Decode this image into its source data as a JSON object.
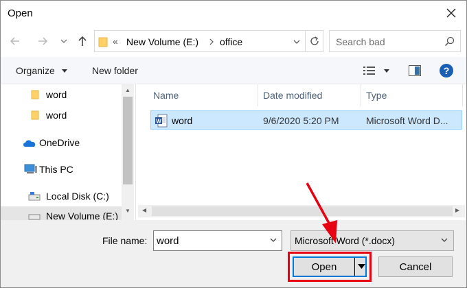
{
  "window": {
    "title": "Open"
  },
  "nav": {
    "path": [
      "New Volume (E:)",
      "office"
    ],
    "path_prefix": "«",
    "search_placeholder": "Search bad"
  },
  "toolbar": {
    "organize_label": "Organize",
    "new_folder_label": "New folder"
  },
  "sidebar": {
    "items": [
      {
        "label": "word",
        "icon": "folder-icon"
      },
      {
        "label": "word",
        "icon": "folder-icon"
      },
      {
        "label": "OneDrive",
        "icon": "onedrive-icon"
      },
      {
        "label": "This PC",
        "icon": "computer-icon"
      },
      {
        "label": "Local Disk (C:)",
        "icon": "drive-icon"
      },
      {
        "label": "New Volume (E:)",
        "icon": "drive-icon"
      }
    ]
  },
  "file_list": {
    "columns": [
      "Name",
      "Date modified",
      "Type"
    ],
    "rows": [
      {
        "name": "word",
        "date": "9/6/2020 5:20 PM",
        "type": "Microsoft Word D..."
      }
    ]
  },
  "footer": {
    "file_name_label": "File name:",
    "file_name_value": "word",
    "file_type_value": "Microsoft Word (*.docx)",
    "open_label": "Open",
    "cancel_label": "Cancel"
  },
  "colors": {
    "selection": "#cce8ff",
    "accent": "#0078d7",
    "highlight": "#e60012"
  }
}
